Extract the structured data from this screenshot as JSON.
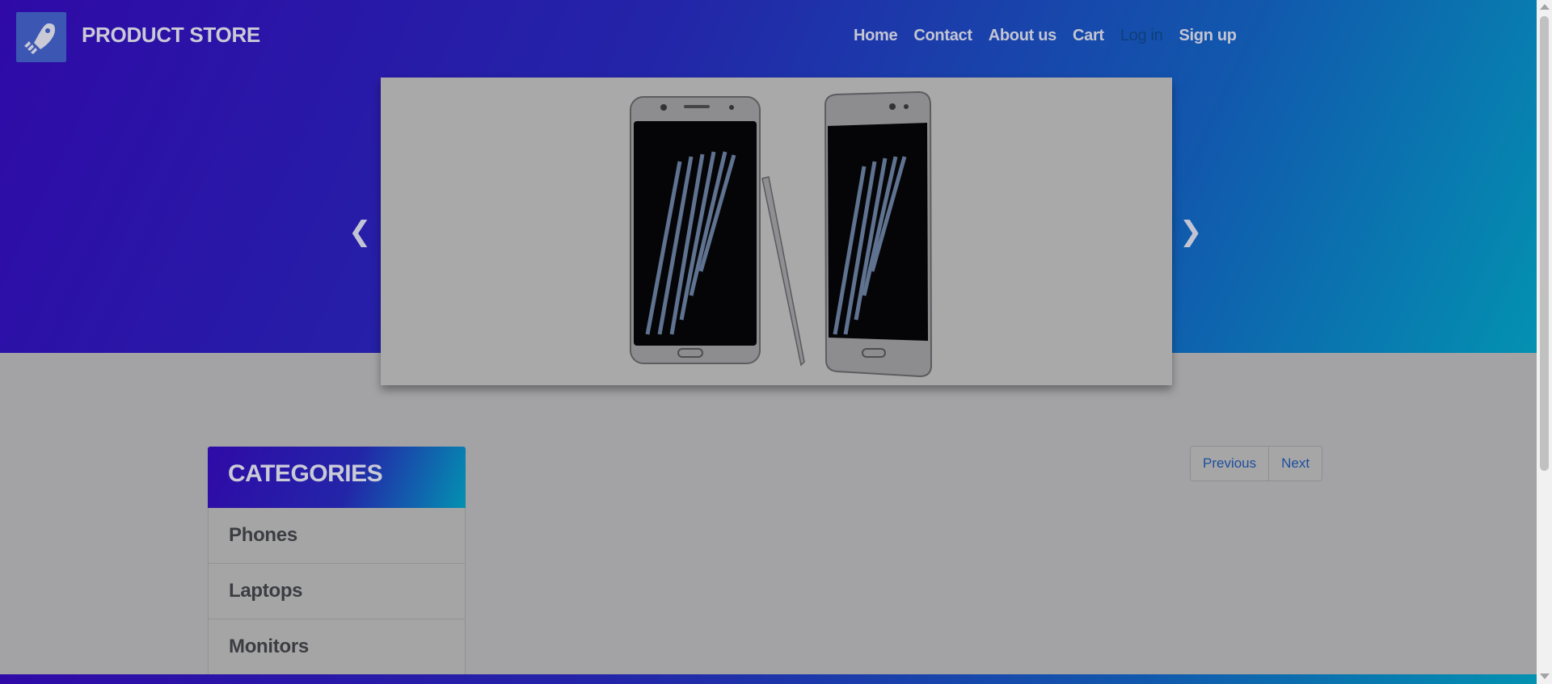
{
  "header": {
    "brand": "PRODUCT STORE",
    "logo_icon": "rocket-icon",
    "nav": {
      "home": "Home",
      "contact": "Contact",
      "about": "About us",
      "cart": "Cart",
      "login": "Log in",
      "signup": "Sign up"
    }
  },
  "carousel": {
    "prev_icon": "chevron-left-icon",
    "next_icon": "chevron-right-icon",
    "prev_glyph": "❮",
    "next_glyph": "❯"
  },
  "categories": {
    "title": "CATEGORIES",
    "items": [
      "Phones",
      "Laptops",
      "Monitors"
    ]
  },
  "pagination": {
    "previous": "Previous",
    "next": "Next"
  },
  "colors": {
    "gradient_start": "#2f0aa7",
    "gradient_end": "#0391b1",
    "login_link": "#0f3f7c",
    "pager_link": "#1c4f9e"
  }
}
